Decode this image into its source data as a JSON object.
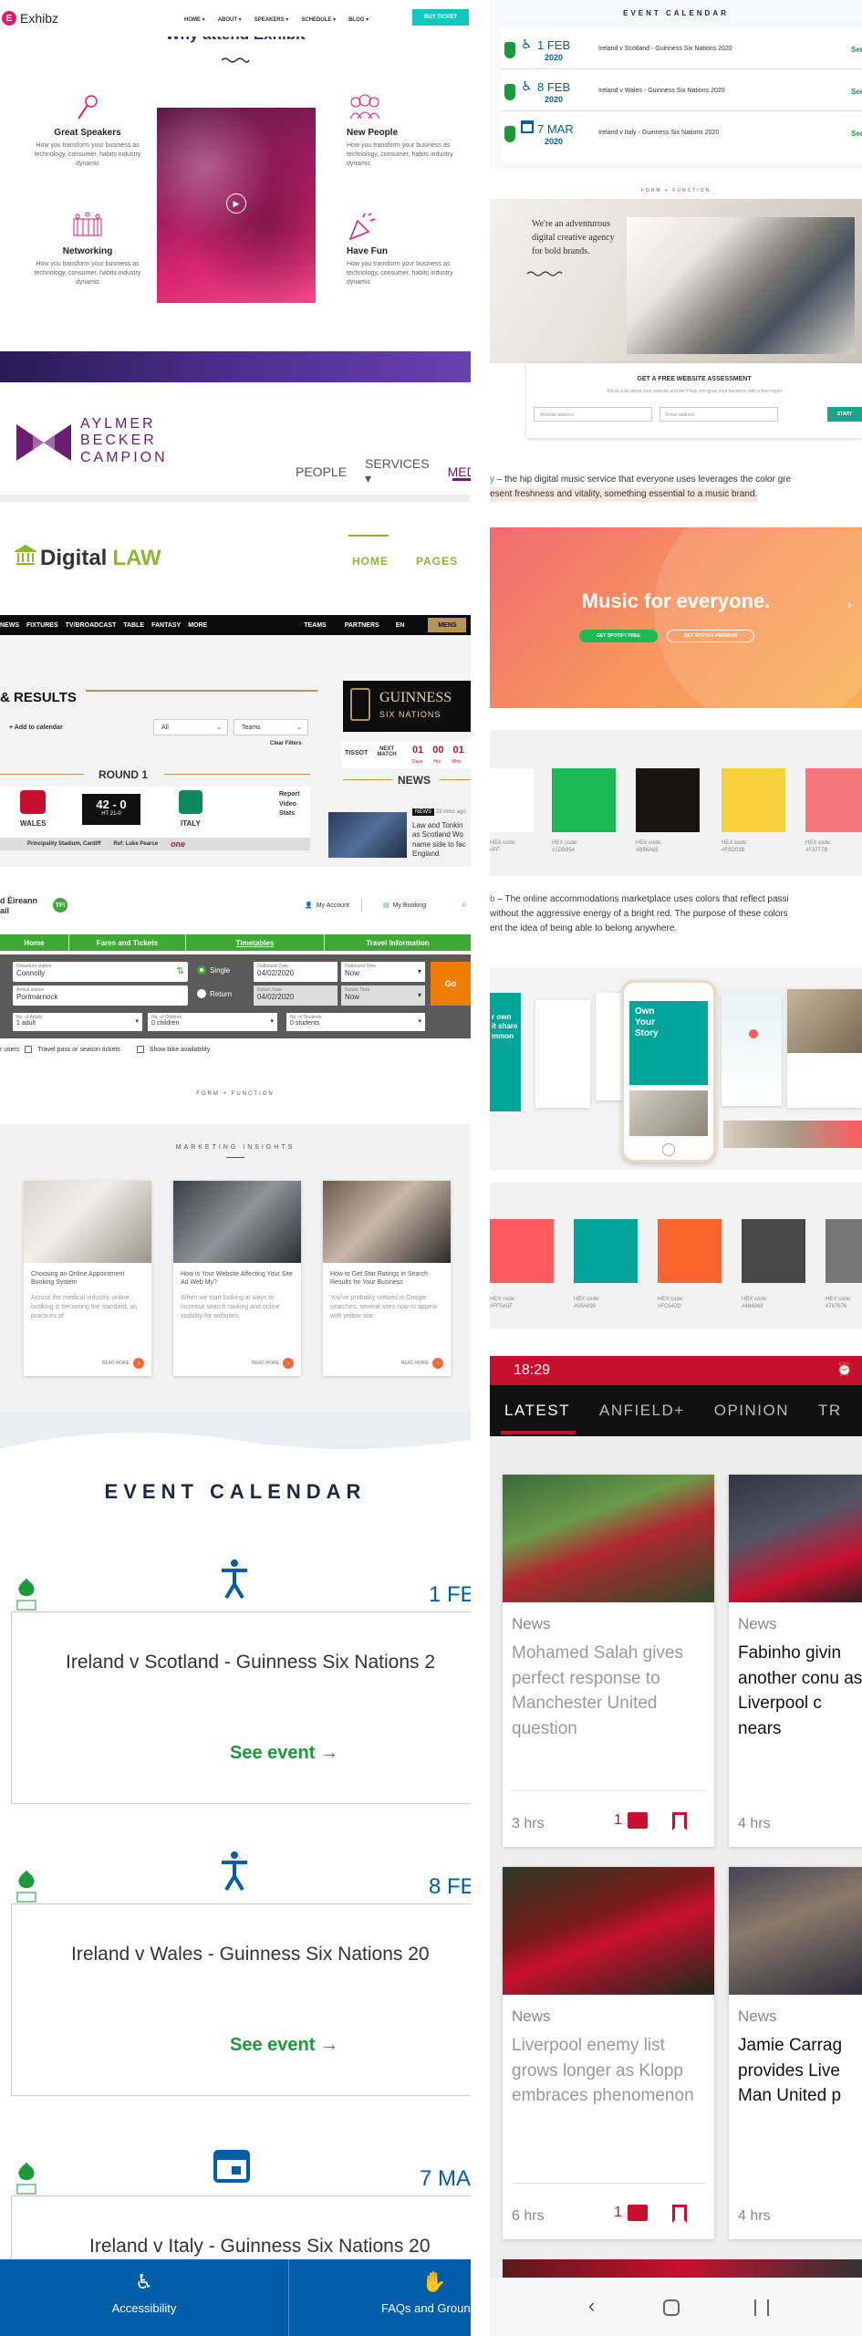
{
  "exhibz": {
    "logo": "Exhibz",
    "menu": [
      "HOME ▾",
      "ABOUT ▾",
      "SPEAKERS ▾",
      "SCHEDULE ▾",
      "BLOG ▾"
    ],
    "buy": "BUY TICKET",
    "title": "Why attend Exhibit",
    "features": [
      {
        "title": "Great Speakers",
        "text": "How you transform your business as technology, consumer, habits industry dynamic"
      },
      {
        "title": "New People",
        "text": "How you transform your business as technology, consumer, habits industry dynamic"
      },
      {
        "title": "Networking",
        "text": "How you transform your business as technology, consumer, habits industry dynamic"
      },
      {
        "title": "Have Fun",
        "text": "How you transform your business as technology, consumer, habits industry dynamic"
      }
    ]
  },
  "aylmer": {
    "name": [
      "AYLMER",
      "BECKER",
      "CAMPION"
    ],
    "nav": [
      "PEOPLE",
      "SERVICES ▾",
      "MED"
    ]
  },
  "digital_law": {
    "name_a": "Digital",
    "name_b": "LAW",
    "nav": [
      "HOME",
      "PAGES"
    ]
  },
  "rugby": {
    "topnav": [
      "NEWS",
      "FIXTURES",
      "TV/BROADCAST",
      "TABLE",
      "FANTASY",
      "MORE"
    ],
    "rightnav": [
      "TEAMS",
      "PARTNERS",
      "EN"
    ],
    "mens": "MENS",
    "heading": "& RESULTS",
    "add_cal": "+ Add to calendar",
    "filter1": "All",
    "filter2": "Teams",
    "clear": "Clear Filters",
    "round": "ROUND 1",
    "home": "WALES",
    "away": "ITALY",
    "score": "42 - 0",
    "ht": "HT 21-0",
    "links": [
      "Report",
      "Video",
      "Stats"
    ],
    "stadium": "Principality Stadium, Cardiff",
    "ref": "Ref: Luke Pearce",
    "sponsor": "one",
    "guinness": [
      "GUINNESS",
      "SIX NATIONS"
    ],
    "tissot": "TISSOT",
    "next_match": "NEXT MATCH",
    "countdown": [
      "01",
      "00",
      "01"
    ],
    "countdown_units": [
      "Days",
      "Hrs",
      "Mins"
    ],
    "news_head": "NEWS",
    "news_tag": "NEWS",
    "news_time": "29 mins ago",
    "news_text": "Law and Tonkin as Scotland Wo name side to fac England"
  },
  "irish_rail": {
    "brand": [
      "d Éireann",
      "ail"
    ],
    "my_account": "My Account",
    "my_booking": "My Booking",
    "tabs": [
      "Home",
      "Fares and Tickets",
      "Timetables",
      "Travel Information"
    ],
    "fields": [
      {
        "label": "Departure station",
        "value": "Connolly"
      },
      {
        "label": "Arrival station",
        "value": "Portmarnock"
      }
    ],
    "single": "Single",
    "return": "Return",
    "out_date_label": "Outbound Date",
    "out_date": "04/02/2020",
    "out_time_label": "Outbound Time",
    "out_time": "Now",
    "ret_date_label": "Return Date",
    "ret_date": "04/02/2020",
    "ret_time_label": "Return Time",
    "ret_time": "Now",
    "adults_label": "No. of Adults",
    "adults": "1 adult",
    "children_label": "No. of Children",
    "children": "0 children",
    "students_label": "No. of Students",
    "students": "0 students",
    "go": "Go",
    "note1": "r users",
    "note2": "Travel pass or season tickets",
    "note3": "Show bike availability"
  },
  "form_function_1": "FORM + FUNCTION",
  "insights": {
    "title": "MARKETING INSIGHTS",
    "cards": [
      {
        "title": "Choosing an Online Appointment Booking System",
        "text": "Across the medical industry, online booking is becoming the standard, as practices of",
        "more": "READ MORE"
      },
      {
        "title": "How is Your Website Affecting Your Site Ad Web My?",
        "text": "When we start looking at ways to increase search ranking and online visibility for websites,",
        "more": "READ MORE"
      },
      {
        "title": "How to Get Star Ratings in Search Results for Your Business",
        "text": "You've probably noticed in Google searches, several sites now to appear with yellow star",
        "more": "READ MORE"
      }
    ]
  },
  "event_calendar": {
    "title": "EVENT CALENDAR",
    "events": [
      {
        "date": "1 FEB",
        "match": "Ireland v Scotland - Guinness Six Nations 2",
        "cta": "See event →"
      },
      {
        "date": "8 FEB",
        "match": "Ireland v Wales - Guinness Six Nations 20",
        "cta": "See event →"
      },
      {
        "date": "7 MA",
        "match": "Ireland v Italy - Guinness Six Nations 20",
        "cta": ""
      }
    ],
    "footer": [
      "Accessibility",
      "FAQs and Ground"
    ]
  },
  "event_small": {
    "title": "EVENT CALENDAR",
    "events": [
      {
        "day": "1 FEB",
        "year": "2020",
        "match": "Ireland v Scotland - Guinness Six Nations 2020",
        "cta": "See"
      },
      {
        "day": "8 FEB",
        "year": "2020",
        "match": "Ireland v Wales - Guinness Six Nations 2020",
        "cta": "See"
      },
      {
        "day": "7 MAR",
        "year": "2020",
        "match": "Ireland v Italy - Guinness Six Nations 2020",
        "cta": "See"
      }
    ]
  },
  "agency": {
    "label": "FORM + FUNCTION",
    "quote": [
      "We're an adventurous",
      "digital creative agency",
      "for bold brands."
    ],
    "assessment": "GET A FREE WEBSITE ASSESSMENT",
    "assessment_sub": "Tell us a bit about your website and we'll help you grow your business with a free report",
    "field1": "Website address",
    "field2": "Email address",
    "submit": "START"
  },
  "spotify": {
    "intro_a": "y",
    "intro_b": " – the hip digital music service that everyone uses leverages the color gre",
    "intro_c": "esent freshness and vitality, something essential to a music brand.",
    "headline": "Music for everyone.",
    "btn1": "GET SPOTIFY FREE",
    "btn2": "GET SPOTIFY PREMIUM",
    "swatches": [
      {
        "color": "#FFFFFF",
        "code": "HEX code:",
        "hex": "#FF"
      },
      {
        "color": "#1DB954",
        "code": "HEX code:",
        "hex": "#1DB954"
      },
      {
        "color": "#191414",
        "code": "HEX code:",
        "hex": "#B58A65"
      },
      {
        "color": "#F9D03B",
        "code": "HEX code:",
        "hex": "#F9D03B"
      },
      {
        "color": "#F3777B",
        "code": "HEX code:",
        "hex": "#F3777B"
      }
    ]
  },
  "airbnb": {
    "intro_a": "b",
    "intro_b": " – The online accommodations marketplace uses colors that reflect passi",
    "intro_c": "without the aggressive energy of a bright red. The purpose of these colors",
    "intro_d": "ent the idea of being able to belong anywhere.",
    "phone_text": [
      "Own",
      "Your",
      "Story"
    ],
    "side_text": [
      "r own",
      "it share",
      "mmon"
    ],
    "swatches": [
      {
        "color": "#FF5A5F",
        "code": "HEX code:",
        "hex": "#FF5A5F"
      },
      {
        "color": "#00A699",
        "code": "HEX code:",
        "hex": "#00A699"
      },
      {
        "color": "#FC642D",
        "code": "HEX code:",
        "hex": "#FC642D"
      },
      {
        "color": "#484848",
        "code": "HEX code:",
        "hex": "#484848"
      },
      {
        "color": "#767676",
        "code": "HEX code:",
        "hex": "#767676"
      }
    ]
  },
  "liverpool": {
    "time": "18:29",
    "tabs": [
      "LATEST",
      "ANFIELD+",
      "OPINION",
      "TR"
    ],
    "cards": [
      {
        "cat": "News",
        "title": "Mohamed Salah gives perfect response to Manchester United question",
        "ago": "3 hrs",
        "comments": "1"
      },
      {
        "cat": "News",
        "title": "Fabinho givin another conu as Liverpool c nears",
        "ago": "4 hrs",
        "comments": ""
      },
      {
        "cat": "News",
        "title": "Liverpool enemy list grows longer as Klopp embraces phenomenon",
        "ago": "6 hrs",
        "comments": "1"
      },
      {
        "cat": "News",
        "title": "Jamie Carrag provides Live Man United p",
        "ago": "4 hrs",
        "comments": ""
      }
    ]
  },
  "colors": {
    "exhibz_pink": "#e6186e",
    "teal": "#15c6c0",
    "navy": "#2b2a6e",
    "purple": "#6b1e6e",
    "law_green": "#8bb82c",
    "rugby_gold": "#b8935a",
    "rail_green": "#3eaa35",
    "rail_orange": "#ef7d00",
    "irfu_blue": "#005ea8",
    "irfu_green": "#1a9a3a",
    "lfc_red": "#c8102e"
  }
}
